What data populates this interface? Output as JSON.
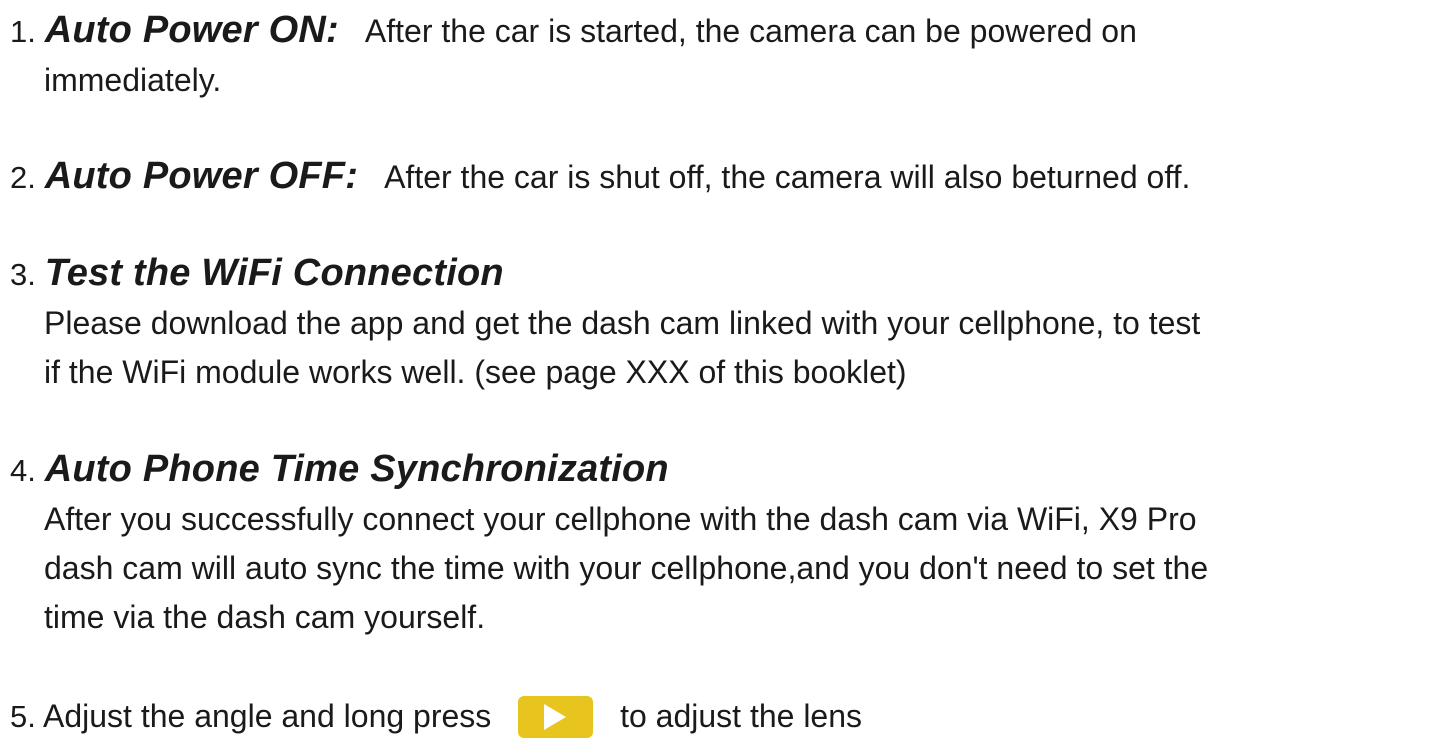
{
  "items": [
    {
      "number": "1.",
      "heading": "Auto Power ON:",
      "text_lines": [
        "After the car is started, the camera can be powered on",
        "immediately."
      ]
    },
    {
      "number": "2.",
      "heading": "Auto Power OFF:",
      "text_lines": [
        "After the car is shut off, the camera will also beturned off."
      ]
    },
    {
      "number": "3.",
      "heading": "Test the WiFi Connection",
      "text_lines": [
        "Please download the app and get the dash cam linked with your cellphone, to test",
        "if the WiFi module works well. (see page XXX of this booklet)"
      ]
    },
    {
      "number": "4.",
      "heading": "Auto Phone Time Synchronization",
      "text_lines": [
        "After you successfully connect your cellphone with the dash cam via WiFi, X9 Pro",
        "dash cam will auto sync the time with your cellphone,and you don't need to set the",
        "time via the dash cam yourself."
      ]
    },
    {
      "number": "5.",
      "text_before_icon": "Adjust the angle and long press",
      "icon": "play-icon",
      "icon_color": "#e8c51e",
      "text_after_icon": "to adjust the lens"
    }
  ]
}
